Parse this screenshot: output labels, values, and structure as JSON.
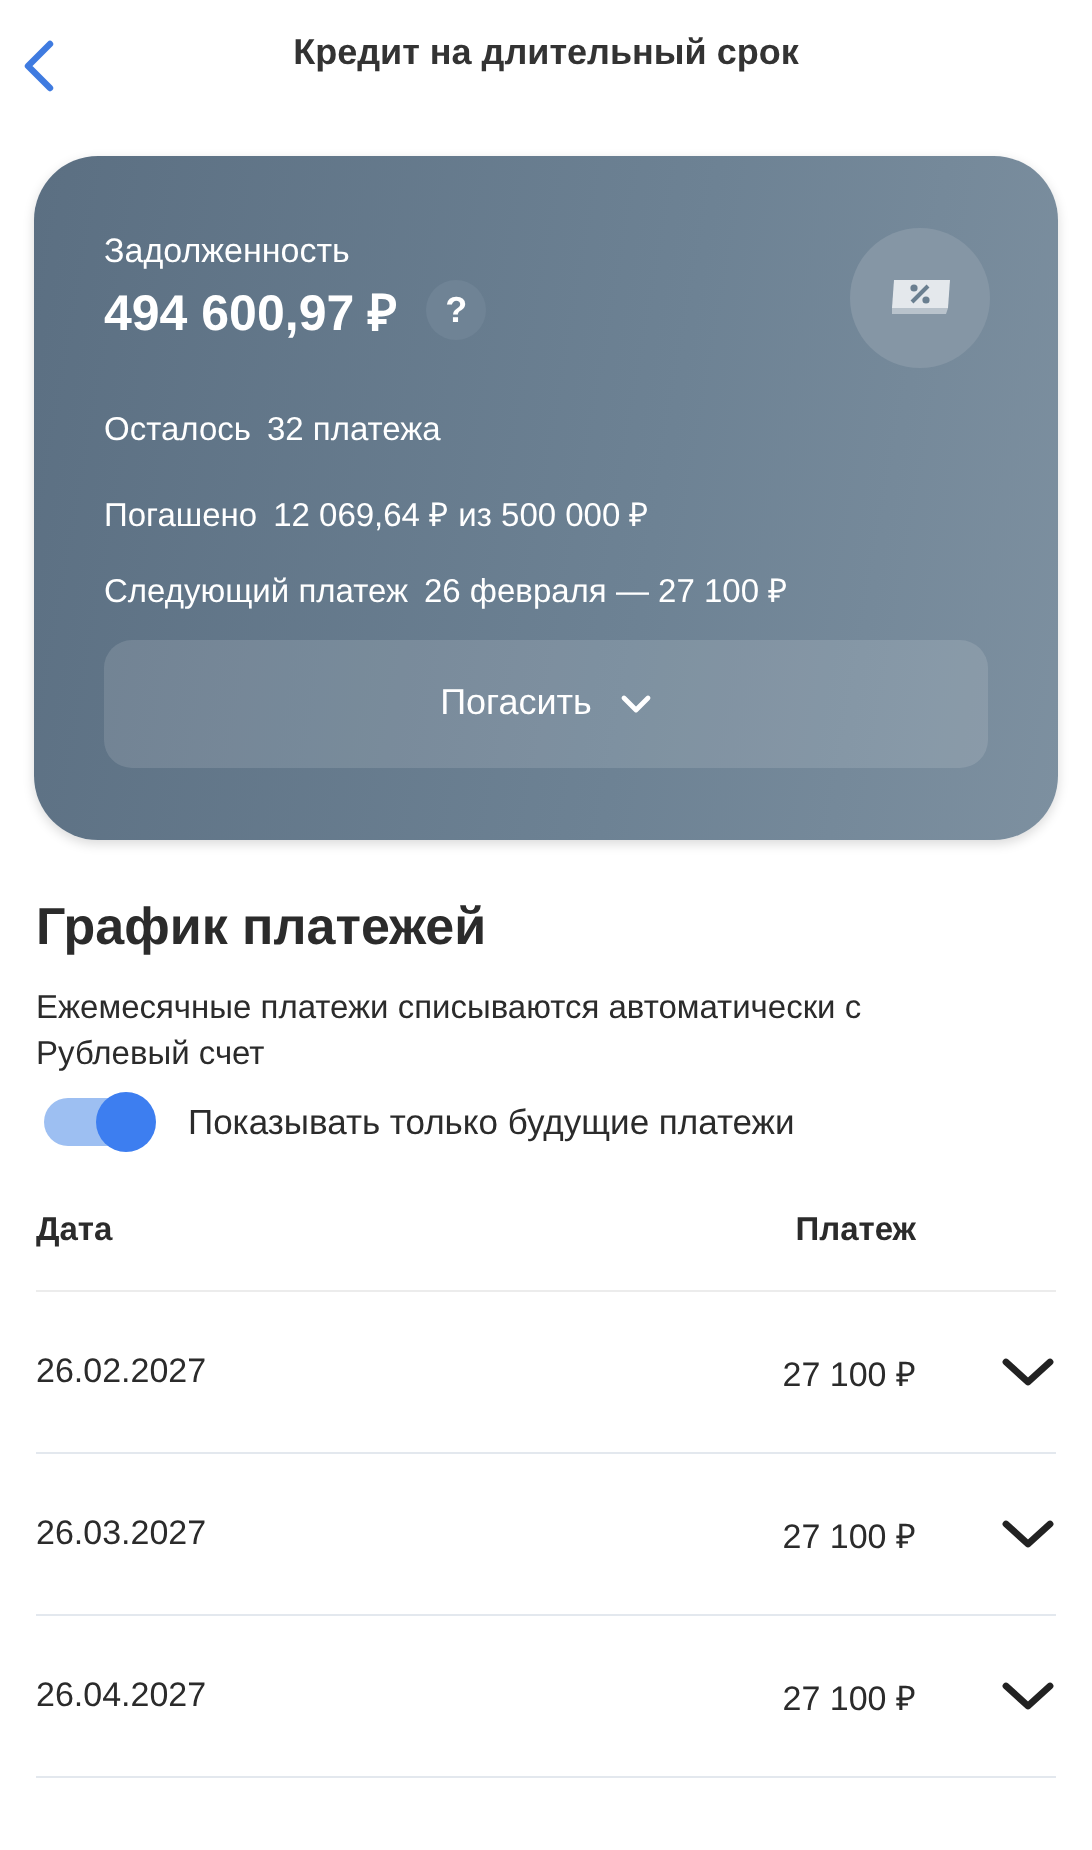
{
  "header": {
    "title": "Кредит на длительный срок"
  },
  "card": {
    "debt_label": "Задолженность",
    "debt_amount": "494 600,97 ₽",
    "help_glyph": "?",
    "details": [
      {
        "label": "Осталось",
        "value": "32 платежа"
      },
      {
        "label": "Погашено",
        "value": "12 069,64 ₽ из 500 000 ₽"
      },
      {
        "label": "Следующий платеж",
        "value": "26 февраля —  27 100 ₽"
      }
    ],
    "repay_button": "Погасить"
  },
  "schedule": {
    "title": "График платежей",
    "note": "Ежемесячные платежи списываются автоматически с Рублевый счет",
    "toggle": {
      "label": "Показывать только будущие платежи",
      "on": true
    },
    "columns": [
      "Дата",
      "Платеж"
    ],
    "rows": [
      {
        "date": "26.02.2027",
        "amount": "27 100 ₽",
        "expanded": false
      },
      {
        "date": "26.03.2027",
        "amount": "27 100 ₽",
        "expanded": false
      },
      {
        "date": "26.04.2027",
        "amount": "27 100 ₽",
        "expanded": false
      }
    ]
  }
}
